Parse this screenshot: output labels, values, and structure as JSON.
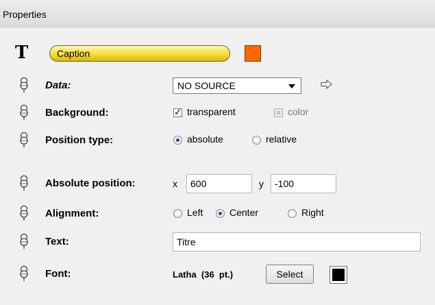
{
  "panel": {
    "title": "Properties"
  },
  "object": {
    "type_icon": "text-T-icon",
    "name": "Caption",
    "color": "#ff6600"
  },
  "properties": {
    "data": {
      "label": "Data:",
      "value": "NO SOURCE",
      "arrow_icon": "arrow-right-icon"
    },
    "background": {
      "label": "Background:",
      "transparent_label": "transparent",
      "transparent_checked": true,
      "color_label": "color",
      "color_checked": false
    },
    "position_type": {
      "label": "Position type:",
      "options": [
        "absolute",
        "relative"
      ],
      "selected": "absolute"
    },
    "absolute_position": {
      "label": "Absolute position:",
      "x_label": "x",
      "x_value": "600",
      "y_label": "y",
      "y_value": "-100"
    },
    "alignment": {
      "label": "Alignment:",
      "options": [
        "Left",
        "Center",
        "Right"
      ],
      "selected": "Center"
    },
    "text": {
      "label": "Text:",
      "value": "Titre"
    },
    "font": {
      "label": "Font:",
      "value": "Latha  (36  pt.)",
      "select_label": "Select",
      "color": "#000000"
    }
  },
  "pin_icon": "pin-icon"
}
